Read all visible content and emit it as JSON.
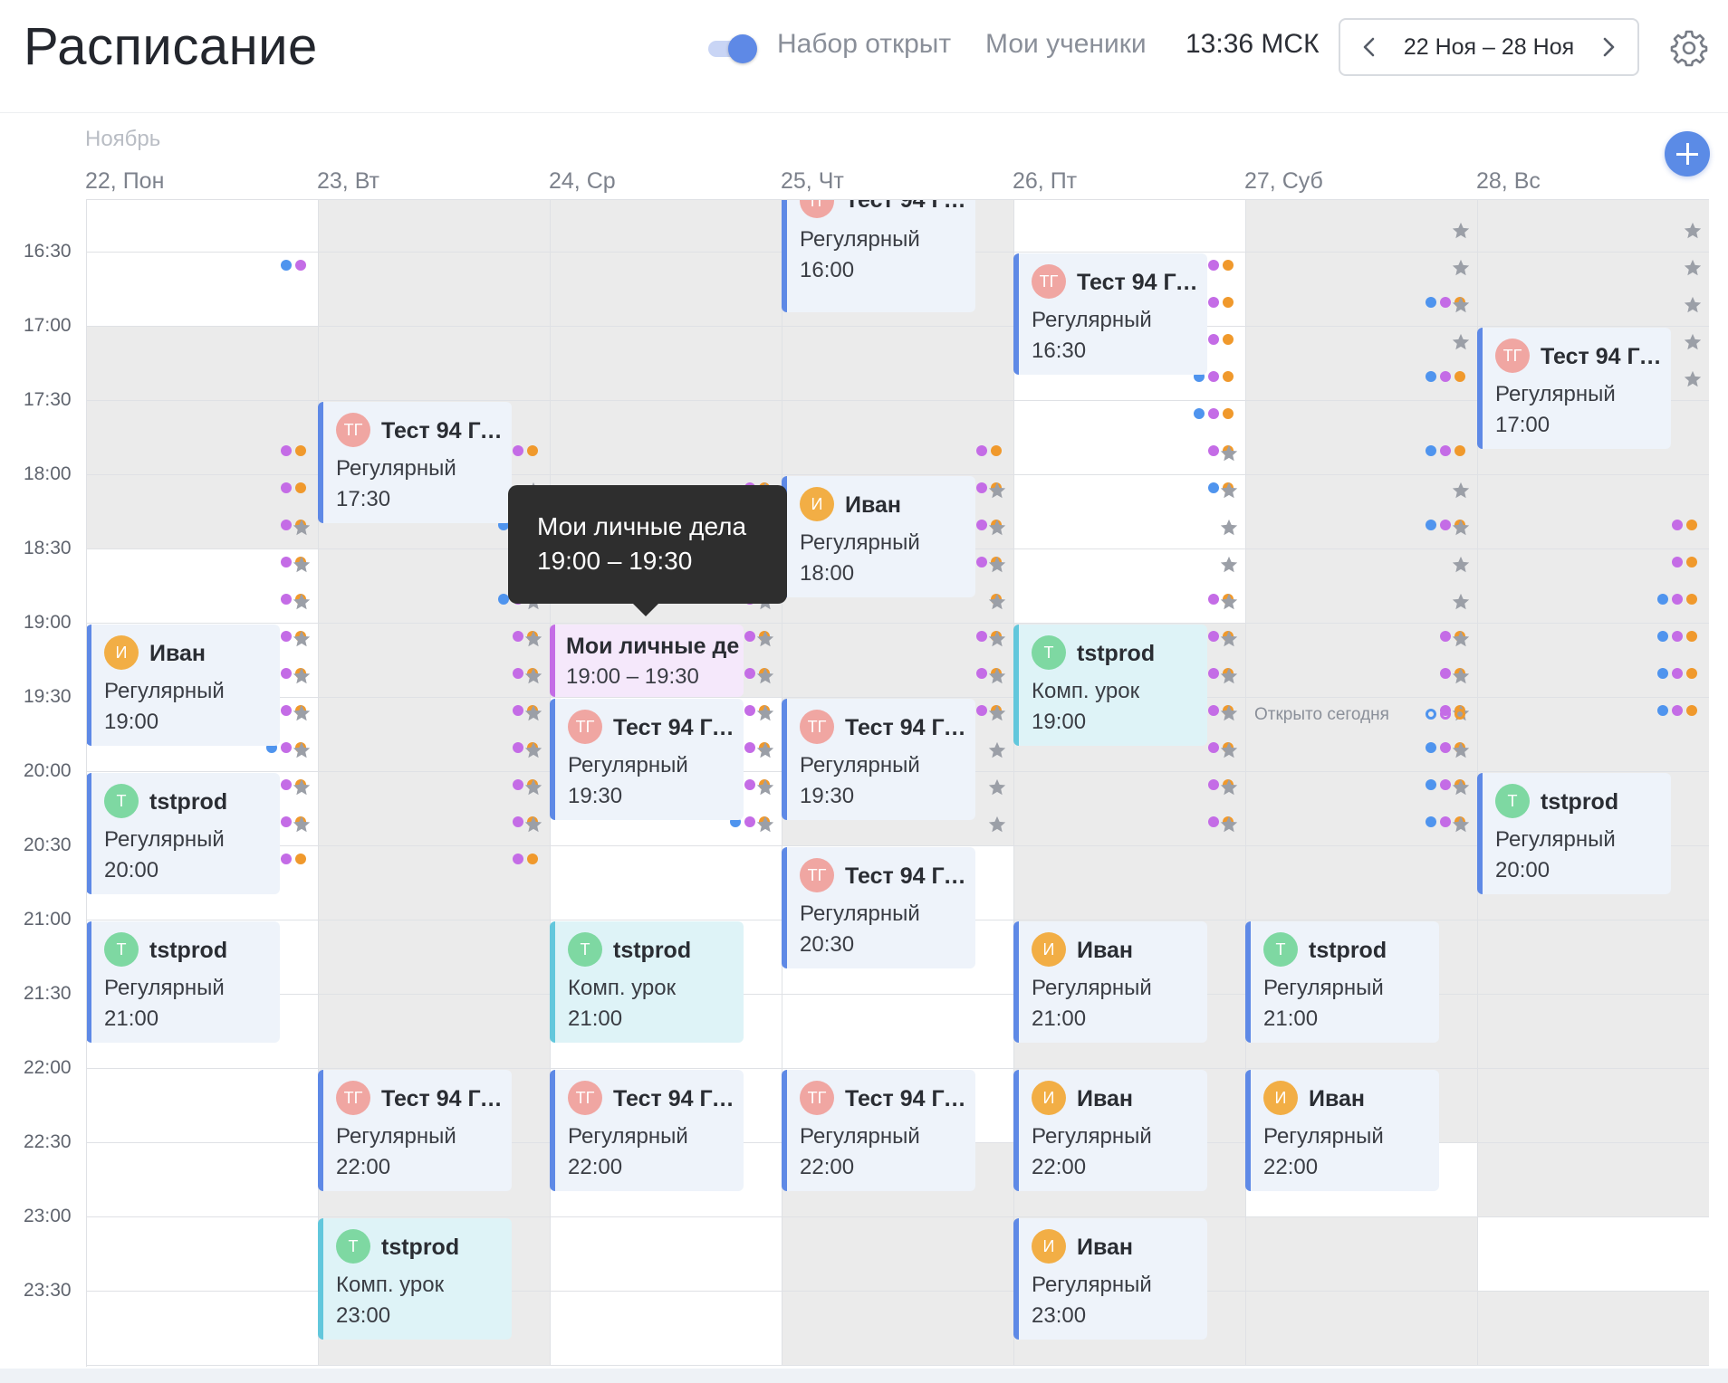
{
  "header": {
    "title": "Расписание",
    "toggle_label": "Набор открыт",
    "my_students": "Мои ученики",
    "clock": "13:36 МСК",
    "week_range": "22 Ноя – 28 Ноя"
  },
  "calendar": {
    "month": "Ноябрь",
    "days": [
      "22, Пон",
      "23, Вт",
      "24, Ср",
      "25, Чт",
      "26, Пт",
      "27, Суб",
      "28, Вс"
    ],
    "times": [
      "16:30",
      "17:00",
      "17:30",
      "18:00",
      "18:30",
      "19:00",
      "19:30",
      "20:00",
      "20:30",
      "21:00",
      "21:30",
      "22:00",
      "22:30",
      "23:00",
      "23:30"
    ],
    "open_today_label": "Открыто сегодня",
    "lessons": [
      {
        "name": "Тест 94 Гу…",
        "initials": "ТГ",
        "avatar_color": "pink",
        "kind": "Регулярный",
        "time": "16:00",
        "style": "regular"
      },
      {
        "name": "Тест 94 Гу…",
        "initials": "ТГ",
        "avatar_color": "pink",
        "kind": "Регулярный",
        "time": "16:30",
        "style": "regular"
      },
      {
        "name": "Тест 94 Гу…",
        "initials": "ТГ",
        "avatar_color": "pink",
        "kind": "Регулярный",
        "time": "17:00",
        "style": "regular"
      },
      {
        "name": "Тест 94 Гу…",
        "initials": "ТГ",
        "avatar_color": "pink",
        "kind": "Регулярный",
        "time": "17:30",
        "style": "regular"
      },
      {
        "name": "Иван",
        "initials": "И",
        "avatar_color": "orange",
        "kind": "Регулярный",
        "time": "18:00",
        "style": "regular"
      },
      {
        "name": "Иван",
        "initials": "И",
        "avatar_color": "orange",
        "kind": "Регулярный",
        "time": "19:00",
        "style": "regular"
      },
      {
        "name": "Мои личные де",
        "kind": "",
        "time": "19:00 – 19:30",
        "style": "personal"
      },
      {
        "name": "tstprod",
        "initials": "T",
        "avatar_color": "green",
        "kind": "Комп. урок",
        "time": "19:00",
        "style": "teal"
      },
      {
        "name": "Тест 94 Гу…",
        "initials": "ТГ",
        "avatar_color": "pink",
        "kind": "Регулярный",
        "time": "19:30",
        "style": "regular"
      },
      {
        "name": "Тест 94 Гу…",
        "initials": "ТГ",
        "avatar_color": "pink",
        "kind": "Регулярный",
        "time": "19:30",
        "style": "regular"
      },
      {
        "name": "tstprod",
        "initials": "T",
        "avatar_color": "green",
        "kind": "Регулярный",
        "time": "20:00",
        "style": "regular"
      },
      {
        "name": "tstprod",
        "initials": "T",
        "avatar_color": "green",
        "kind": "Регулярный",
        "time": "20:00",
        "style": "regular"
      },
      {
        "name": "Тест 94 Гу…",
        "initials": "ТГ",
        "avatar_color": "pink",
        "kind": "Регулярный",
        "time": "20:30",
        "style": "regular"
      },
      {
        "name": "tstprod",
        "initials": "T",
        "avatar_color": "green",
        "kind": "Регулярный",
        "time": "21:00",
        "style": "regular"
      },
      {
        "name": "tstprod",
        "initials": "T",
        "avatar_color": "green",
        "kind": "Комп. урок",
        "time": "21:00",
        "style": "teal"
      },
      {
        "name": "Иван",
        "initials": "И",
        "avatar_color": "orange",
        "kind": "Регулярный",
        "time": "21:00",
        "style": "regular"
      },
      {
        "name": "tstprod",
        "initials": "T",
        "avatar_color": "green",
        "kind": "Регулярный",
        "time": "21:00",
        "style": "regular"
      },
      {
        "name": "Тест 94 Гу…",
        "initials": "ТГ",
        "avatar_color": "pink",
        "kind": "Регулярный",
        "time": "22:00",
        "style": "regular"
      },
      {
        "name": "Тест 94 Гу…",
        "initials": "ТГ",
        "avatar_color": "pink",
        "kind": "Регулярный",
        "time": "22:00",
        "style": "regular"
      },
      {
        "name": "Тест 94 Гу…",
        "initials": "ТГ",
        "avatar_color": "pink",
        "kind": "Регулярный",
        "time": "22:00",
        "style": "regular"
      },
      {
        "name": "Иван",
        "initials": "И",
        "avatar_color": "orange",
        "kind": "Регулярный",
        "time": "22:00",
        "style": "regular"
      },
      {
        "name": "Иван",
        "initials": "И",
        "avatar_color": "orange",
        "kind": "Регулярный",
        "time": "22:00",
        "style": "regular"
      },
      {
        "name": "tstprod",
        "initials": "T",
        "avatar_color": "green",
        "kind": "Комп. урок",
        "time": "23:00",
        "style": "teal"
      },
      {
        "name": "Иван",
        "initials": "И",
        "avatar_color": "orange",
        "kind": "Регулярный",
        "time": "23:00",
        "style": "regular"
      }
    ]
  },
  "tooltip": {
    "title": "Мои личные дела",
    "time": "19:00 – 19:30"
  },
  "icons": {
    "toggle": "toggle-switch",
    "prev": "chevron-left-icon",
    "next": "chevron-right-icon",
    "settings": "gear-icon",
    "add": "plus-icon",
    "favorite": "star-icon"
  },
  "colors": {
    "accent": "#5e89e6",
    "dot_blue": "#4f94ee",
    "dot_purple": "#c46ce6",
    "dot_orange": "#f0992c",
    "teal_border": "#62c7dc",
    "busy_slot": "#ebebeb"
  }
}
